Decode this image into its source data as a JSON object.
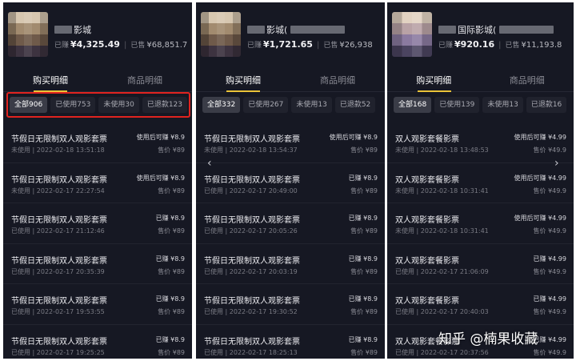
{
  "panels": [
    {
      "shop_name": "影城",
      "earned_label": "已赚",
      "earned_value": "¥4,325.49",
      "sold_label": "已售",
      "sold_value": "¥68,851.7",
      "tab_left": "购买明细",
      "tab_right": "商品明细",
      "filters": [
        "全部906",
        "已使用753",
        "未使用30",
        "已退款123"
      ],
      "rows": [
        {
          "title": "节假日无限制双人观影套票",
          "sub": "未使用 | 2022-02-18 13:51:18",
          "earn": "使用后可赚 ¥8.9",
          "price": "售价 ¥89"
        },
        {
          "title": "节假日无限制双人观影套票",
          "sub": "未使用 | 2022-02-17 22:27:54",
          "earn": "使用后可赚 ¥8.9",
          "price": "售价 ¥89"
        },
        {
          "title": "节假日无限制双人观影套票",
          "sub": "已使用 | 2022-02-17 21:12:46",
          "earn": "已赚 ¥8.9",
          "price": "售价 ¥89"
        },
        {
          "title": "节假日无限制双人观影套票",
          "sub": "已使用 | 2022-02-17 20:35:39",
          "earn": "已赚 ¥8.9",
          "price": "售价 ¥89"
        },
        {
          "title": "节假日无限制双人观影套票",
          "sub": "已使用 | 2022-02-17 19:53:55",
          "earn": "已赚 ¥8.9",
          "price": "售价 ¥89"
        },
        {
          "title": "节假日无限制双人观影套票",
          "sub": "已使用 | 2022-02-17 19:25:25",
          "earn": "已赚 ¥8.9",
          "price": "售价 ¥89"
        }
      ]
    },
    {
      "shop_name": "影城(",
      "earned_label": "已赚",
      "earned_value": "¥1,721.65",
      "sold_label": "已售",
      "sold_value": "¥26,938",
      "tab_left": "购买明细",
      "tab_right": "商品明细",
      "filters": [
        "全部332",
        "已使用267",
        "未使用13",
        "已退款52"
      ],
      "rows": [
        {
          "title": "节假日无限制双人观影套票",
          "sub": "未使用 | 2022-02-18 13:54:37",
          "earn": "使用后可赚 ¥8.9",
          "price": "售价 ¥89"
        },
        {
          "title": "节假日无限制双人观影套票",
          "sub": "已使用 | 2022-02-17 20:49:00",
          "earn": "已赚 ¥8.9",
          "price": "售价 ¥89"
        },
        {
          "title": "节假日无限制双人观影套票",
          "sub": "已使用 | 2022-02-17 20:05:26",
          "earn": "已赚 ¥8.9",
          "price": "售价 ¥89"
        },
        {
          "title": "节假日无限制双人观影套票",
          "sub": "已使用 | 2022-02-17 20:03:19",
          "earn": "已赚 ¥8.9",
          "price": "售价 ¥89"
        },
        {
          "title": "节假日无限制双人观影套票",
          "sub": "已使用 | 2022-02-17 19:30:52",
          "earn": "已赚 ¥8.9",
          "price": "售价 ¥89"
        },
        {
          "title": "节假日无限制双人观影套票",
          "sub": "已使用 | 2022-02-17 18:25:13",
          "earn": "已赚 ¥8.9",
          "price": "售价 ¥89"
        }
      ]
    },
    {
      "shop_name": "国际影城(",
      "earned_label": "已赚",
      "earned_value": "¥920.16",
      "sold_label": "已售",
      "sold_value": "¥11,193.8",
      "tab_left": "购买明细",
      "tab_right": "商品明细",
      "filters": [
        "全部168",
        "已使用139",
        "未使用13",
        "已退款16"
      ],
      "rows": [
        {
          "title": "双人观影套餐影票",
          "sub": "未使用 | 2022-02-18 13:48:53",
          "earn": "使用后可赚 ¥4.99",
          "price": "售价 ¥49.9"
        },
        {
          "title": "双人观影套餐影票",
          "sub": "未使用 | 2022-02-18 10:31:41",
          "earn": "使用后可赚 ¥4.99",
          "price": "售价 ¥49.9"
        },
        {
          "title": "双人观影套餐影票",
          "sub": "未使用 | 2022-02-18 10:31:41",
          "earn": "使用后可赚 ¥4.99",
          "price": "售价 ¥49.9"
        },
        {
          "title": "双人观影套餐影票",
          "sub": "已使用 | 2022-02-17 21:06:09",
          "earn": "已赚 ¥4.99",
          "price": "售价 ¥49.9"
        },
        {
          "title": "双人观影套餐影票",
          "sub": "已使用 | 2022-02-17 20:40:03",
          "earn": "已赚 ¥4.99",
          "price": "售价 ¥49.9"
        },
        {
          "title": "双人观影套餐影票",
          "sub": "已使用 | 2022-02-17 20:37:56",
          "earn": "已赚 ¥4.99",
          "price": "售价 ¥49.9"
        }
      ]
    }
  ],
  "nav": {
    "prev": "‹",
    "next": "›"
  },
  "watermark": "知乎 @楠果收藏",
  "colors": {
    "panel_bg": "#161823",
    "accent_underline": "#e9c238",
    "highlight_box": "#e0231f"
  }
}
